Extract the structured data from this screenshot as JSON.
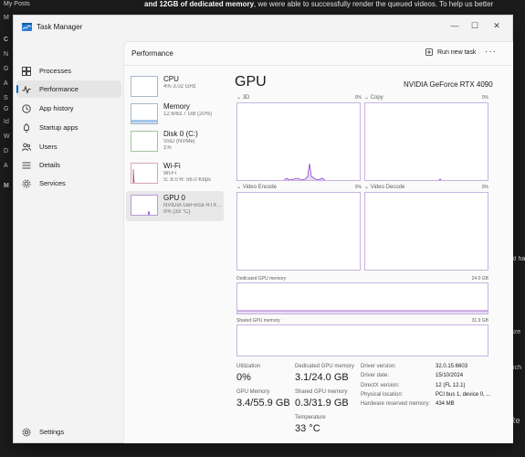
{
  "background": {
    "sidebar_items": [
      "My Posts",
      "M",
      "C",
      "N",
      "G",
      "A",
      "S",
      "G",
      "Id",
      "W",
      "D",
      "A",
      "M"
    ],
    "top_text_bold": "and 12GB of dedicated memory",
    "top_text_rest": ", we were able to successfully render the queued videos. To help us better",
    "right_fragments": [
      "u",
      "the",
      "n and ha",
      "had",
      "ptimize",
      "re.",
      "n touch",
      "Re"
    ]
  },
  "window": {
    "app_title": "Task Manager",
    "controls": {
      "minimize": "—",
      "maximize": "☐",
      "close": "✕"
    }
  },
  "nav": {
    "items": [
      {
        "label": "Processes",
        "icon": "processes-icon"
      },
      {
        "label": "Performance",
        "icon": "performance-icon"
      },
      {
        "label": "App history",
        "icon": "app-history-icon"
      },
      {
        "label": "Startup apps",
        "icon": "startup-apps-icon"
      },
      {
        "label": "Users",
        "icon": "users-icon"
      },
      {
        "label": "Details",
        "icon": "details-icon"
      },
      {
        "label": "Services",
        "icon": "services-icon"
      }
    ],
    "settings_label": "Settings"
  },
  "header": {
    "title": "Performance",
    "run_task_label": "Run new task",
    "more_label": "···"
  },
  "devices": [
    {
      "name": "CPU",
      "line1": "4% 3.02 GHz",
      "line2": ""
    },
    {
      "name": "Memory",
      "line1": "12.6/63.7 GB (20%)",
      "line2": ""
    },
    {
      "name": "Disk 0 (C:)",
      "line1": "SSD (NVMe)",
      "line2": "1%"
    },
    {
      "name": "Wi-Fi",
      "line1": "Wi-Fi",
      "line2": "S: 8.0 R: 56.0 Kbps"
    },
    {
      "name": "GPU 0",
      "line1": "NVIDIA GeForce RTX ...",
      "line2": "0% (33 °C)"
    }
  ],
  "gpu": {
    "title": "GPU",
    "model": "NVIDIA GeForce RTX 4090",
    "engines": [
      {
        "name": "3D",
        "percent": "0%"
      },
      {
        "name": "Copy",
        "percent": "0%"
      },
      {
        "name": "Video Encode",
        "percent": "0%"
      },
      {
        "name": "Video Decode",
        "percent": "0%"
      }
    ],
    "dedicated_memory_label": "Dedicated GPU memory",
    "dedicated_memory_max": "24.0 GB",
    "shared_memory_label": "Shared GPU memory",
    "shared_memory_max": "31.9 GB",
    "stats": {
      "utilization_label": "Utilization",
      "utilization_value": "0%",
      "dedicated_label": "Dedicated GPU memory",
      "dedicated_value": "3.1/24.0 GB",
      "gpu_memory_label": "GPU Memory",
      "gpu_memory_value": "3.4/55.9 GB",
      "shared_label": "Shared GPU memory",
      "shared_value": "0.3/31.9 GB",
      "temperature_label": "Temperature",
      "temperature_value": "33 °C"
    },
    "info": [
      {
        "label": "Driver version:",
        "value": "32.0.15.6603"
      },
      {
        "label": "Driver date:",
        "value": "15/10/2024"
      },
      {
        "label": "DirectX version:",
        "value": "12 (FL 12.1)"
      },
      {
        "label": "Physical location:",
        "value": "PCI bus 1, device 0, ..."
      },
      {
        "label": "Hardware reserved memory:",
        "value": "434 MB"
      }
    ]
  },
  "colors": {
    "accent": "#0067c0",
    "gpu_line": "#8e44c9",
    "gpu_fill": "#e9dcf5",
    "memory_fill": "#c9daf0"
  }
}
